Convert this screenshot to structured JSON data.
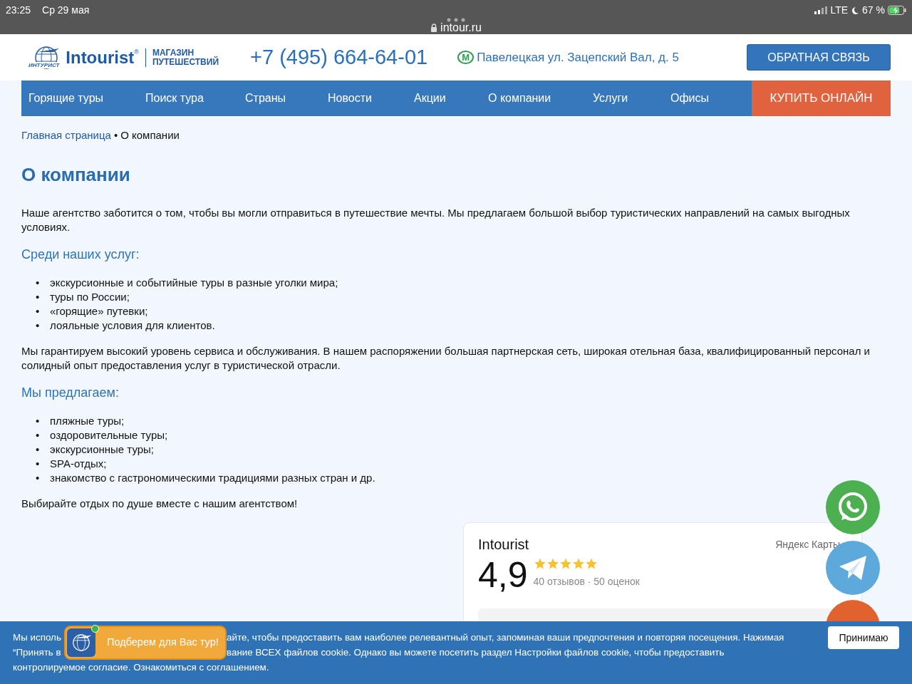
{
  "status_bar": {
    "time": "23:25",
    "date": "Ср 29 мая",
    "network": "LTE",
    "battery": "67 %",
    "url": "intour.ru"
  },
  "header": {
    "logo_text": "Intourist",
    "logo_mark": "®",
    "logo_badge": "ИНТУРИСТ",
    "tagline": [
      "МАГАЗИН",
      "ПУТЕШЕСТВИЙ"
    ],
    "phone": "+7 (495) 664-64-01",
    "metro_letter": "М",
    "address": "Павелецкая ул. Зацепский Вал, д. 5",
    "feedback_button": "ОБРАТНАЯ СВЯЗЬ"
  },
  "nav": {
    "items": [
      "Горящие туры",
      "Поиск тура",
      "Страны",
      "Новости",
      "Акции",
      "О компании",
      "Услуги",
      "Офисы"
    ],
    "buy_button": "КУПИТЬ ОНЛАЙН"
  },
  "breadcrumbs": [
    {
      "label": "Главная страница",
      "link": true
    },
    {
      "label": "О компании",
      "link": false
    }
  ],
  "breadcrumb_separator": "•",
  "title": "О компании",
  "list_marker": "•",
  "sections": [
    {
      "kind": "paragraph",
      "text": "Наше агентство заботится о том, чтобы вы могли отправиться в путешествие мечты. Мы предлагаем большой выбор туристических направлений на самых выгодных условиях."
    },
    {
      "kind": "heading",
      "text": "Среди наших услуг:"
    },
    {
      "kind": "list",
      "items": [
        "экскурсионные и событийные туры в разные уголки мира;",
        "туры по России;",
        "«горящие» путевки;",
        "лояльные условия для клиентов."
      ]
    },
    {
      "kind": "paragraph",
      "text": "Мы гарантируем высокий уровень сервиса и обслуживания. В нашем распоряжении большая партнерская сеть, широкая отельная база, квалифицированный персонал и солидный опыт предоставления услуг в туристической отрасли."
    },
    {
      "kind": "heading",
      "text": "Мы предлагаем:"
    },
    {
      "kind": "list",
      "items": [
        "пляжные туры;",
        "оздоровительные туры;",
        "экскурсионные туры;",
        "SPA-отдых;",
        "знакомство с гастрономическими традициями разных стран и др."
      ]
    },
    {
      "kind": "paragraph",
      "text": "Выбирайте отдых по душе вместе с нашим агентством!"
    }
  ],
  "review_card": {
    "name": "Intourist",
    "source": "Яндекс Карты",
    "rating": "4,9",
    "stars": 5,
    "counts": "40 отзывов · 50 оценок"
  },
  "cookie_bar": {
    "lines": [
      [
        "Мы исполь",
        "айте, чтобы предоставить вам наиболее релевантный опыт, запоминая ваши предпочтения и повторяя посещения. Нажимая"
      ],
      [
        "“Принять в",
        "вание ВСЕХ файлов cookie. Однако вы можете посетить раздел Настройки файлов cookie, чтобы предоставить"
      ],
      [
        "контролируемое согласие. Ознакомиться с соглашением."
      ]
    ],
    "accept_button": "Принимаю"
  },
  "chat_widget": {
    "text": "Подберем для Вас тур!",
    "online": true
  }
}
